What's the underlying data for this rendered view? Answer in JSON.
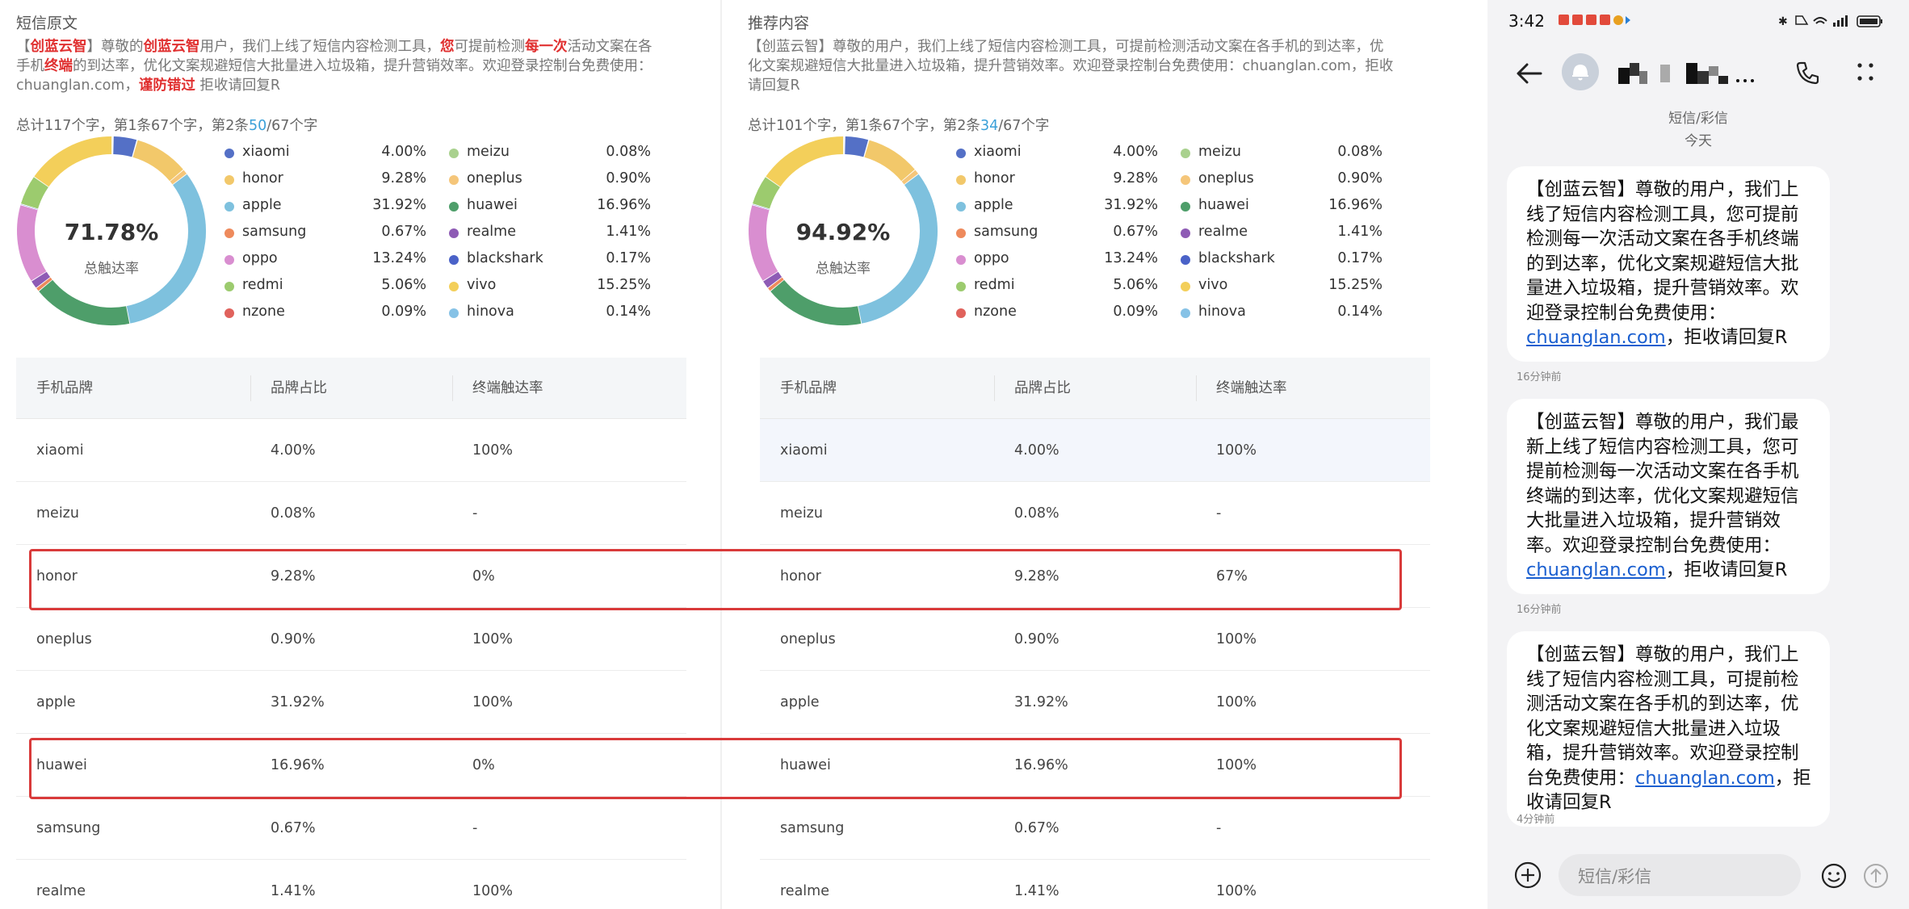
{
  "left_panel": {
    "title": "短信原文",
    "text_parts": [
      {
        "t": "【"
      },
      {
        "t": "创蓝云智",
        "red": true
      },
      {
        "t": "】尊敬的"
      },
      {
        "t": "创蓝云智",
        "red": true
      },
      {
        "t": "用户，我们上线了短信内容检测工具，"
      },
      {
        "t": "您",
        "red": true
      },
      {
        "t": "可提前检测"
      },
      {
        "t": "每一次",
        "red": true
      },
      {
        "t": "活动文案在各手机"
      },
      {
        "t": "终端",
        "red": true
      },
      {
        "t": "的到达率，优化文案规避短信大批量进入垃圾箱，提升营销效率。欢迎登录控制台免费使用：chuanglan.com，"
      },
      {
        "t": "谨防错过",
        "red": true
      },
      {
        "t": " 拒收请回复R"
      }
    ],
    "stats_prefix": "总计117个字，第1条67个字，第2条",
    "stats_highlight": "50",
    "stats_suffix": "/67个字",
    "rate": "71.78%",
    "rate_label": "总触达率",
    "headers": [
      "手机品牌",
      "品牌占比",
      "终端触达率"
    ],
    "rows": [
      {
        "brand": "xiaomi",
        "share": "4.00%",
        "rate": "100%"
      },
      {
        "brand": "meizu",
        "share": "0.08%",
        "rate": "-"
      },
      {
        "brand": "honor",
        "share": "9.28%",
        "rate": "0%"
      },
      {
        "brand": "oneplus",
        "share": "0.90%",
        "rate": "100%"
      },
      {
        "brand": "apple",
        "share": "31.92%",
        "rate": "100%"
      },
      {
        "brand": "huawei",
        "share": "16.96%",
        "rate": "0%"
      },
      {
        "brand": "samsung",
        "share": "0.67%",
        "rate": "-"
      },
      {
        "brand": "realme",
        "share": "1.41%",
        "rate": "100%"
      }
    ]
  },
  "right_panel": {
    "title": "推荐内容",
    "text_parts": [
      {
        "t": "【创蓝云智】尊敬的用户，我们上线了短信内容检测工具，可提前检测活动文案在各手机的到达率，优化文案规避短信大批量进入垃圾箱，提升营销效率。欢迎登录控制台免费使用：chuanglan.com，拒收请回复R"
      }
    ],
    "stats_prefix": "总计101个字，第1条67个字，第2条",
    "stats_highlight": "34",
    "stats_suffix": "/67个字",
    "rate": "94.92%",
    "rate_label": "总触达率",
    "headers": [
      "手机品牌",
      "品牌占比",
      "终端触达率"
    ],
    "rows": [
      {
        "brand": "xiaomi",
        "share": "4.00%",
        "rate": "100%"
      },
      {
        "brand": "meizu",
        "share": "0.08%",
        "rate": "-"
      },
      {
        "brand": "honor",
        "share": "9.28%",
        "rate": "67%"
      },
      {
        "brand": "oneplus",
        "share": "0.90%",
        "rate": "100%"
      },
      {
        "brand": "apple",
        "share": "31.92%",
        "rate": "100%"
      },
      {
        "brand": "huawei",
        "share": "16.96%",
        "rate": "100%"
      },
      {
        "brand": "samsung",
        "share": "0.67%",
        "rate": "-"
      },
      {
        "brand": "realme",
        "share": "1.41%",
        "rate": "100%"
      }
    ]
  },
  "legend": [
    {
      "name": "xiaomi",
      "value": "4.00%",
      "pct": 4.0,
      "color": "#5470c6"
    },
    {
      "name": "honor",
      "value": "9.28%",
      "pct": 9.28,
      "color": "#f2c86a"
    },
    {
      "name": "apple",
      "value": "31.92%",
      "pct": 31.92,
      "color": "#7ec1de"
    },
    {
      "name": "samsung",
      "value": "0.67%",
      "pct": 0.67,
      "color": "#ee8a5c"
    },
    {
      "name": "oppo",
      "value": "13.24%",
      "pct": 13.24,
      "color": "#d98ed0"
    },
    {
      "name": "redmi",
      "value": "5.06%",
      "pct": 5.06,
      "color": "#9ccb6e"
    },
    {
      "name": "nzone",
      "value": "0.09%",
      "pct": 0.09,
      "color": "#e0625c"
    },
    {
      "name": "meizu",
      "value": "0.08%",
      "pct": 0.08,
      "color": "#a9d18e"
    },
    {
      "name": "oneplus",
      "value": "0.90%",
      "pct": 0.9,
      "color": "#f5c67a"
    },
    {
      "name": "huawei",
      "value": "16.96%",
      "pct": 16.96,
      "color": "#4e9e6a"
    },
    {
      "name": "realme",
      "value": "1.41%",
      "pct": 1.41,
      "color": "#8e5bb5"
    },
    {
      "name": "blackshark",
      "value": "0.17%",
      "pct": 0.17,
      "color": "#4a62c8"
    },
    {
      "name": "vivo",
      "value": "15.25%",
      "pct": 15.25,
      "color": "#f3cf5a"
    },
    {
      "name": "hinova",
      "value": "0.14%",
      "pct": 0.14,
      "color": "#86c2e6"
    }
  ],
  "phone": {
    "time": "3:42",
    "category": "短信/彩信",
    "day": "今天",
    "messages": [
      {
        "pre": "【创蓝云智】尊敬的用户，我们上线了短信内容检测工具，您可提前检测每一次活动文案在各手机终端的到达率，优化文案规避短信大批量进入垃圾箱，提升营销效率。欢迎登录控制台免费使用：",
        "link": "chuanglan.com",
        "post": "，拒收请回复R",
        "time": "16分钟前"
      },
      {
        "pre": "【创蓝云智】尊敬的用户，我们最新上线了短信内容检测工具，您可提前检测每一次活动文案在各手机终端的到达率，优化文案规避短信大批量进入垃圾箱，提升营销效率。欢迎登录控制台免费使用：",
        "link": "chuanglan.com",
        "post": "，拒收请回复R",
        "time": "16分钟前"
      },
      {
        "pre": "【创蓝云智】尊敬的用户，我们上线了短信内容检测工具，可提前检测活动文案在各手机的到达率，优化文案规避短信大批量进入垃圾箱，提升营销效率。欢迎登录控制台免费使用：",
        "link": "chuanglan.com",
        "post": "，拒收请回复R",
        "time": "4分钟前"
      }
    ],
    "input_placeholder": "短信/彩信"
  }
}
